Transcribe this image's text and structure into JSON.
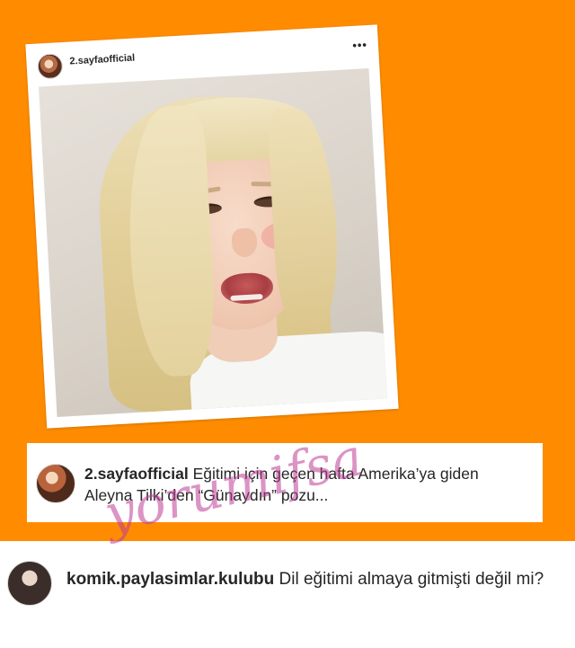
{
  "post": {
    "username": "2.sayfaofficial",
    "more_icon": "more-horizontal-icon"
  },
  "caption": {
    "username": "2.sayfaofficial",
    "text": "Eğitimi için geçen hafta Amerika’ya giden Aleyna Tilki’den “Günaydın” pozu..."
  },
  "comment": {
    "username": "komik.paylasimlar.kulubu",
    "text": "Dil eğitimi almaya gitmişti değil mi?"
  },
  "watermark": "yorumifsa",
  "colors": {
    "background": "#ff8c00",
    "card": "#ffffff",
    "text": "#262626",
    "watermark": "#be3c96"
  }
}
